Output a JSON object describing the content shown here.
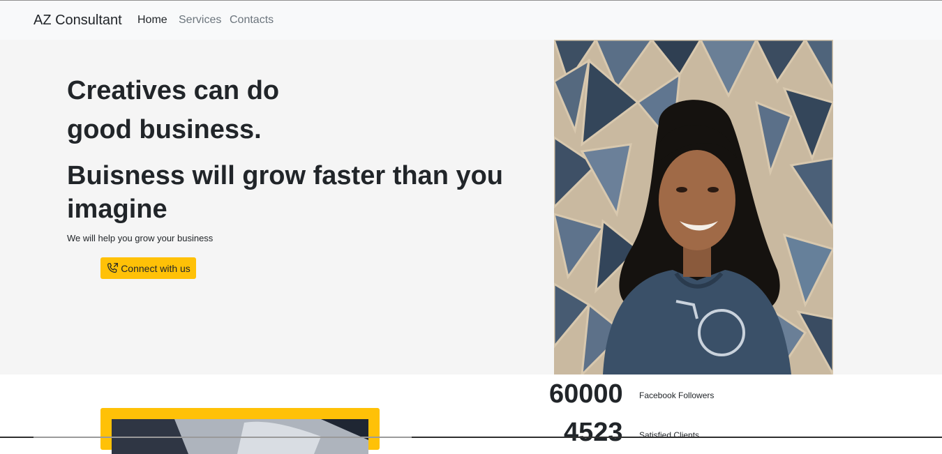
{
  "nav": {
    "brand": "AZ Consultant",
    "links": [
      "Home",
      "Services",
      "Contacts"
    ]
  },
  "hero": {
    "headline_line1": "Creatives can do",
    "headline_line2": "good business.",
    "subheadline": "Buisness will grow faster than you imagine",
    "lead": "We will help you grow your business",
    "cta_label": "Connect with us"
  },
  "stats": [
    {
      "value": "60000",
      "label": "Facebook Followers"
    },
    {
      "value": "4523",
      "label": "Satisfied Clients"
    }
  ],
  "colors": {
    "accent": "#ffc107",
    "navbar_bg": "#f8f9fa",
    "hero_bg": "#f5f5f5"
  },
  "icons": {
    "cta": "phone-outgoing-icon"
  }
}
